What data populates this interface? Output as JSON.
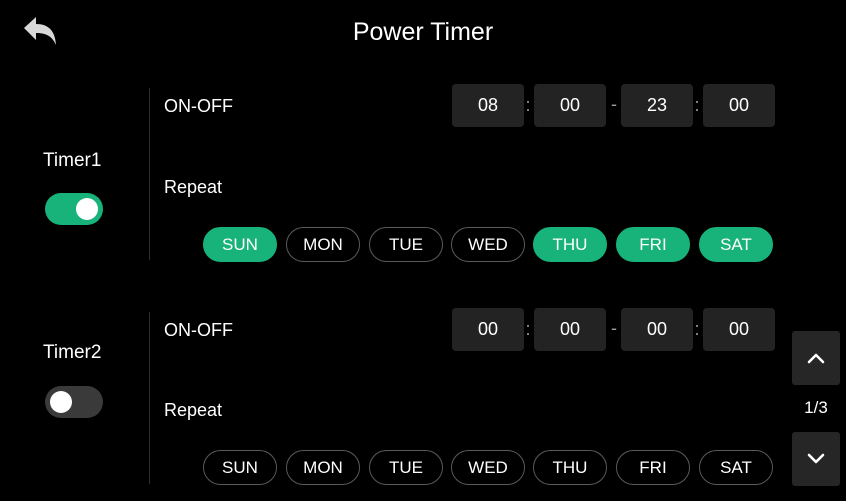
{
  "header": {
    "title": "Power Timer",
    "back_icon": "back-arrow-icon"
  },
  "timers": [
    {
      "label": "Timer1",
      "enabled": true,
      "on_off_label": "ON-OFF",
      "start_hour": "08",
      "start_min": "00",
      "end_hour": "23",
      "end_min": "00",
      "colon": ":",
      "dash": "-",
      "repeat_label": "Repeat",
      "days": [
        {
          "label": "SUN",
          "on": true
        },
        {
          "label": "MON",
          "on": false
        },
        {
          "label": "TUE",
          "on": false
        },
        {
          "label": "WED",
          "on": false
        },
        {
          "label": "THU",
          "on": true
        },
        {
          "label": "FRI",
          "on": true
        },
        {
          "label": "SAT",
          "on": true
        }
      ]
    },
    {
      "label": "Timer2",
      "enabled": false,
      "on_off_label": "ON-OFF",
      "start_hour": "00",
      "start_min": "00",
      "end_hour": "00",
      "end_min": "00",
      "colon": ":",
      "dash": "-",
      "repeat_label": "Repeat",
      "days": [
        {
          "label": "SUN",
          "on": false
        },
        {
          "label": "MON",
          "on": false
        },
        {
          "label": "TUE",
          "on": false
        },
        {
          "label": "WED",
          "on": false
        },
        {
          "label": "THU",
          "on": false
        },
        {
          "label": "FRI",
          "on": false
        },
        {
          "label": "SAT",
          "on": false
        }
      ]
    }
  ],
  "pager": {
    "text": "1/3",
    "up_icon": "chevron-up-icon",
    "down_icon": "chevron-down-icon"
  },
  "colors": {
    "accent": "#17b37a",
    "box": "#232323",
    "background": "#000000"
  }
}
